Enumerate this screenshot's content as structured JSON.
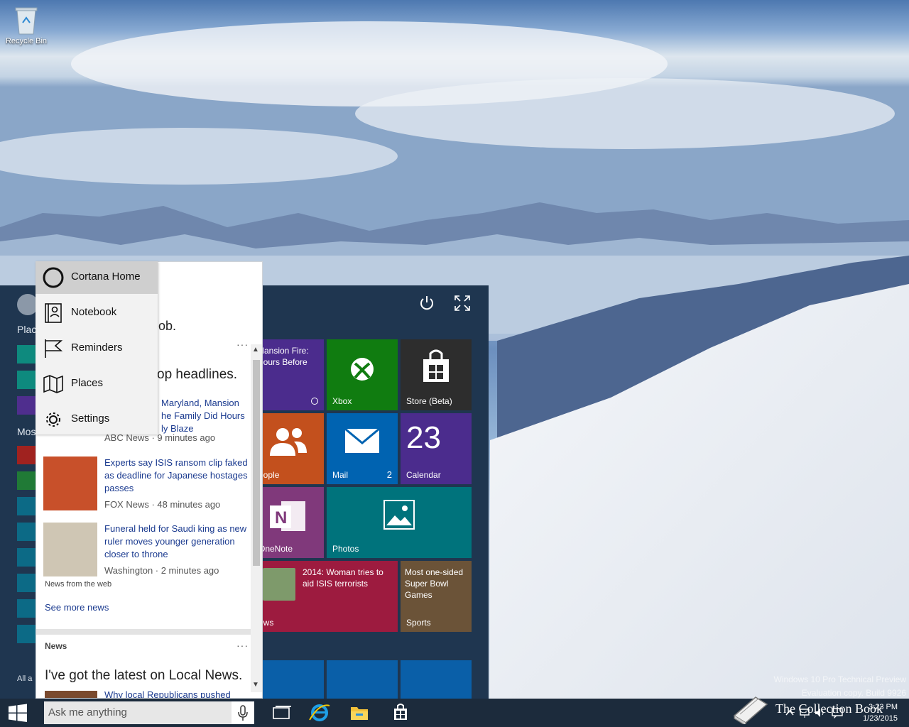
{
  "desktop": {
    "recycle_bin_label": "Recycle Bin"
  },
  "start_menu": {
    "side_labels": [
      "Plac",
      "Mos"
    ],
    "all_apps_label": "All a",
    "tiles": {
      "news_mansion": "Mansion Fire:\nHours Before",
      "xbox": "Xbox",
      "store": "Store (Beta)",
      "people": "eople",
      "mail": "Mail",
      "mail_count": "2",
      "calendar": "Calendar",
      "calendar_day": "23",
      "onenote": "OneNote",
      "photos": "Photos",
      "news2_head": "2014: Woman tries to aid ISIS terrorists",
      "news2_label": "ews",
      "sports_head": "Most one-sided Super Bowl Games",
      "sports_label": "Sports"
    }
  },
  "cortana": {
    "greeting_tail": "ob.",
    "top_headlines": "op headlines.",
    "news": [
      {
        "headline": "Maryland, Mansion\nhe Family Did Hours\nly Blaze",
        "source": "ABC News · 9 minutes ago"
      },
      {
        "headline": "Experts say ISIS ransom clip faked as deadline for Japanese hostages passes",
        "source": "FOX News · 48 minutes ago"
      },
      {
        "headline": "Funeral held for Saudi king as new ruler moves younger generation closer to throne",
        "source": "Washington  · 2 minutes ago"
      }
    ],
    "news_from_web": "News from the web",
    "see_more": "See more news",
    "section_label": "News",
    "local_news_title": "I've got the latest on Local News.",
    "local_news_first": "Why local Republicans pushed"
  },
  "cortana_menu": [
    {
      "label": "Cortana Home",
      "icon": "circle-icon",
      "selected": true
    },
    {
      "label": "Notebook",
      "icon": "notebook-icon"
    },
    {
      "label": "Reminders",
      "icon": "flag-icon"
    },
    {
      "label": "Places",
      "icon": "map-icon"
    },
    {
      "label": "Settings",
      "icon": "gear-icon"
    }
  ],
  "taskbar": {
    "search_placeholder": "Ask me anything",
    "time": "3:23 PM",
    "date": "1/23/2015"
  },
  "watermark": {
    "line1": "Windows 10 Pro Technical Preview",
    "line2": "Evaluation copy. Build 9926",
    "brand": "The Collection Book"
  }
}
